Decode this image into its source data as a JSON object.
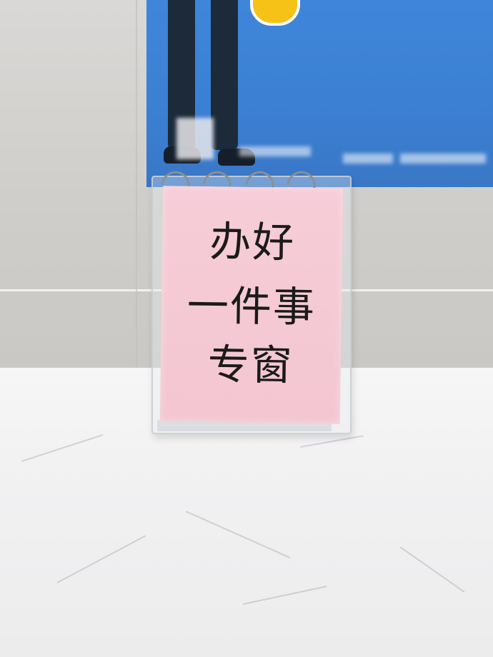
{
  "sign": {
    "lines": [
      "办好",
      "一件事",
      "专窗"
    ]
  },
  "colors": {
    "poster_blue": "#3f86da",
    "paper_pink": "#f4c8d3",
    "accent_yellow": "#f6c218",
    "counter_marble": "#f1f1f2",
    "wall_tile": "#d3d2cf"
  }
}
